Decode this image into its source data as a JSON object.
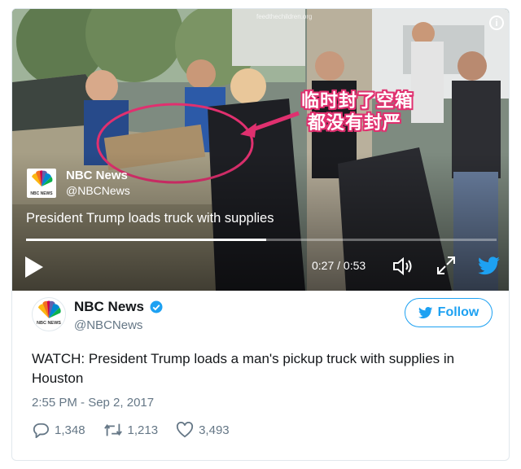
{
  "video": {
    "annotation_line1": "临时封了空箱",
    "annotation_line2": "都没有封严",
    "account_name": "NBC News",
    "account_handle": "@NBCNews",
    "title": "President Trump loads truck with supplies",
    "time": "0:27 / 0:53",
    "progress": 0.51,
    "logo_text": "NBC NEWS",
    "watermark": "feedthechildren.org"
  },
  "tweet": {
    "name": "NBC News",
    "handle": "@NBCNews",
    "follow_label": "Follow",
    "text": "WATCH: President Trump loads a man's pickup truck with supplies in Houston",
    "timestamp": "2:55 PM - Sep 2, 2017",
    "replies": "1,348",
    "retweets": "1,213",
    "likes": "3,493"
  },
  "colors": {
    "twitter_blue": "#1da1f2",
    "annotation_pink": "#e0306f"
  },
  "icons": [
    "info-icon",
    "play-icon",
    "volume-icon",
    "expand-icon",
    "twitter-bird-icon",
    "verified-icon",
    "reply-icon",
    "retweet-icon",
    "like-icon"
  ]
}
